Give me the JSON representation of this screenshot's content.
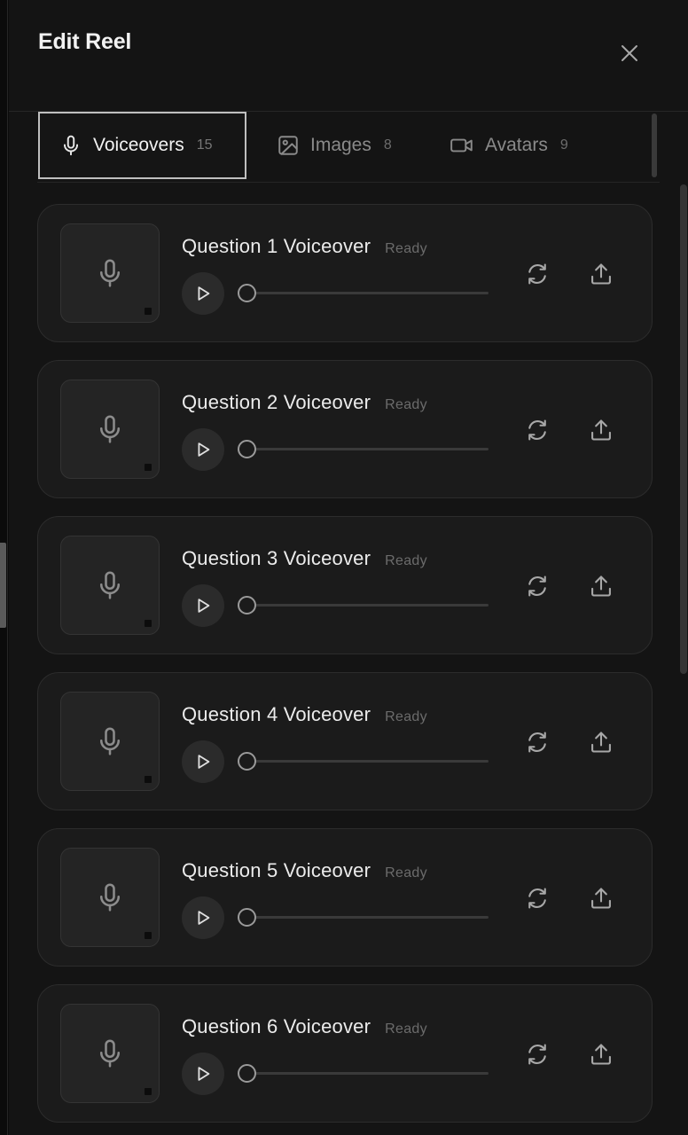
{
  "header": {
    "title": "Edit Reel"
  },
  "tabs": [
    {
      "label": "Voiceovers",
      "count": "15",
      "icon": "microphone-icon",
      "active": true
    },
    {
      "label": "Images",
      "count": "8",
      "icon": "image-icon",
      "active": false
    },
    {
      "label": "Avatars",
      "count": "9",
      "icon": "video-camera-icon",
      "active": false
    }
  ],
  "voiceovers": [
    {
      "title": "Question 1 Voiceover",
      "status": "Ready",
      "progress": 0
    },
    {
      "title": "Question 2 Voiceover",
      "status": "Ready",
      "progress": 0
    },
    {
      "title": "Question 3 Voiceover",
      "status": "Ready",
      "progress": 0
    },
    {
      "title": "Question 4 Voiceover",
      "status": "Ready",
      "progress": 0
    },
    {
      "title": "Question 5 Voiceover",
      "status": "Ready",
      "progress": 0
    },
    {
      "title": "Question 6 Voiceover",
      "status": "Ready",
      "progress": 0
    }
  ],
  "colors": {
    "background": "#141414",
    "card": "#1b1b1b",
    "active_tab_border": "#bfbfbf"
  }
}
